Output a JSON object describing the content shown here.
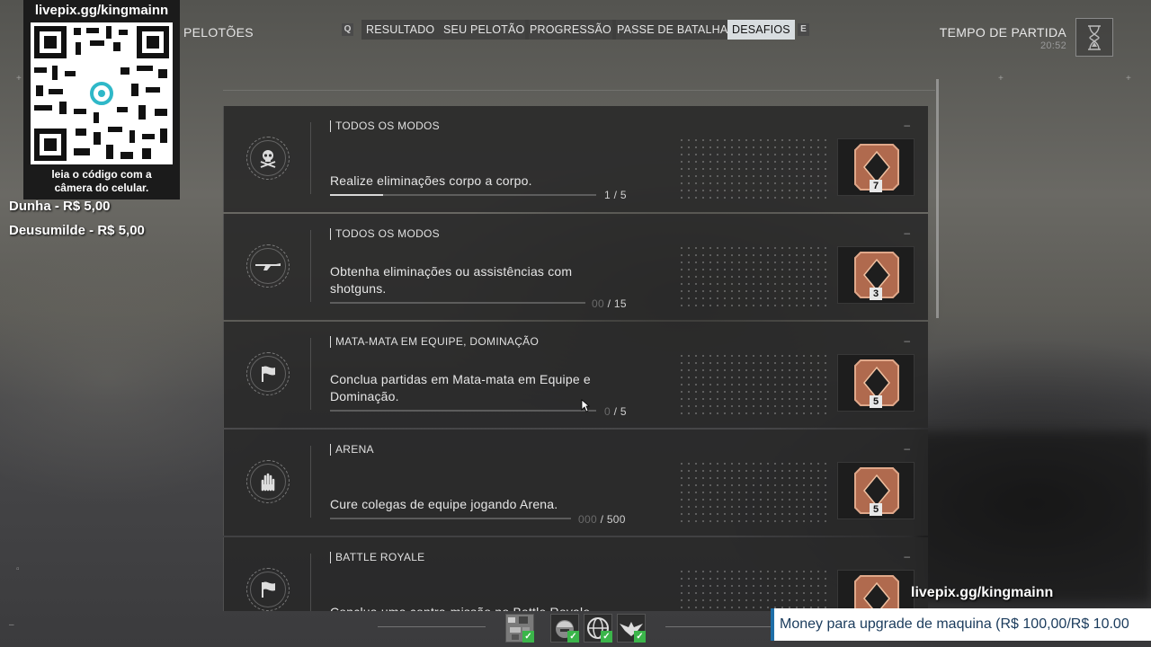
{
  "nav": {
    "section_title": "PELOTÕES",
    "key_left": "Q",
    "key_right": "E",
    "tabs": [
      {
        "label": "RESULTADO",
        "active": false
      },
      {
        "label": "SEU PELOTÃO",
        "active": false
      },
      {
        "label": "PROGRESSÃO",
        "active": false
      },
      {
        "label": "PASSE DE BATALHA",
        "active": false
      },
      {
        "label": "DESAFIOS",
        "active": true
      }
    ]
  },
  "match_time": {
    "label": "TEMPO DE PARTIDA",
    "value": "20:52",
    "icon": "hourglass-icon"
  },
  "overlay": {
    "qr_title": "livepix.gg/kingmainn",
    "qr_caption_line1": "leia o código com a",
    "qr_caption_line2": "câmera do celular.",
    "donors": [
      "Dunha - R$ 5,00",
      "Deusumilde - R$ 5,00"
    ],
    "live_url": "livepix.gg/kingmainn",
    "ticker": "Money para upgrade de maquina (R$ 100,00/R$ 10.00"
  },
  "challenges": [
    {
      "mode": "TODOS OS MODOS",
      "description": "Realize eliminações corpo a corpo.",
      "progress_done": "1",
      "progress_dim": "",
      "progress_total": "/ 5",
      "progress_fraction": 0.2,
      "reward_count": "7",
      "icon": "skull-crossbones-icon",
      "dash": "–"
    },
    {
      "mode": "TODOS OS MODOS",
      "description_line1": "Obtenha eliminações ou assistências com",
      "description_line2": "shotguns.",
      "progress_done": "",
      "progress_dim": "00",
      "progress_total": "/ 15",
      "progress_fraction": 0,
      "reward_count": "3",
      "icon": "shotgun-icon",
      "dash": "–"
    },
    {
      "mode": "MATA-MATA EM EQUIPE, DOMINAÇÃO",
      "description_line1": "Conclua partidas em Mata-mata em Equipe e",
      "description_line2": "Dominação.",
      "progress_done": "",
      "progress_dim": "0",
      "progress_total": "/ 5",
      "progress_fraction": 0,
      "reward_count": "5",
      "icon": "flag-icon",
      "dash": "–"
    },
    {
      "mode": "ARENA",
      "description": "Cure colegas de equipe jogando Arena.",
      "progress_done": "",
      "progress_dim": "000",
      "progress_total": "/ 500",
      "progress_fraction": 0,
      "reward_count": "5",
      "icon": "medic-hand-icon",
      "dash": "–"
    },
    {
      "mode": "BATTLE ROYALE",
      "description": "Conclua uma contra-missão no Battle Royale.",
      "icon": "flag-icon",
      "dash": "–"
    }
  ],
  "squad": [
    {
      "icon": "camo-pattern-icon",
      "ready": true
    },
    {
      "icon": "soldier-helmet-icon",
      "ready": true
    },
    {
      "icon": "globe-emblem-icon",
      "ready": true
    },
    {
      "icon": "eagle-emblem-icon",
      "ready": true
    }
  ],
  "colors": {
    "active_tab_bg": "#d8dde0",
    "reward_bronze": "#b06a4e",
    "ready_green": "#3bb54a"
  }
}
